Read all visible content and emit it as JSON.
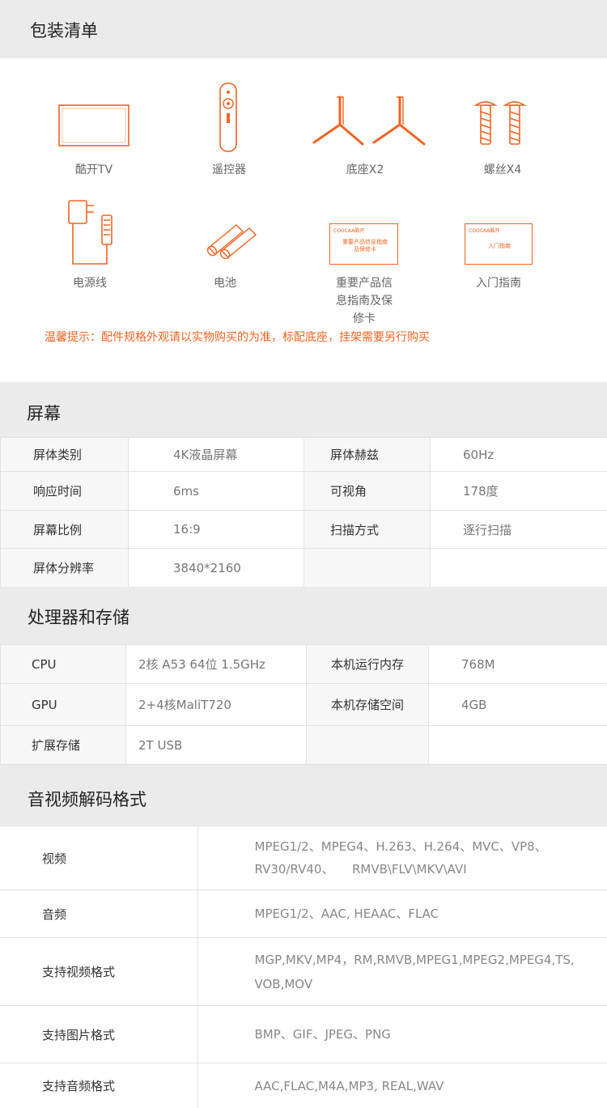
{
  "package": {
    "title": "包装清单",
    "items": [
      {
        "label": "酷开TV"
      },
      {
        "label": "遥控器"
      },
      {
        "label": "底座X2"
      },
      {
        "label": "螺丝X4"
      },
      {
        "label": "电源线"
      },
      {
        "label": "电池"
      },
      {
        "label": "重要产品信息指南及保修卡",
        "card_text": "重要产品信息指南及保修卡",
        "card_brand": "COOCAA酷开"
      },
      {
        "label": "入门指南",
        "card_text": "入门指南",
        "card_brand": "COOCAA酷开"
      }
    ],
    "tip": "温馨提示：配件规格外观请以实物购买的为准，标配底座，挂架需要另行购买"
  },
  "screen": {
    "title": "屏幕",
    "rows": [
      [
        "屏体类别",
        "4K液晶屏幕",
        "屏体赫兹",
        "60Hz"
      ],
      [
        "响应时间",
        "6ms",
        "可视角",
        "178度"
      ],
      [
        "屏幕比例",
        "16:9",
        "扫描方式",
        "逐行扫描"
      ],
      [
        "屏体分辨率",
        "3840*2160",
        "",
        ""
      ]
    ]
  },
  "processor": {
    "title": "处理器和存储",
    "rows": [
      [
        "CPU",
        "2核 A53 64位 1.5GHz",
        "本机运行内存",
        "768M"
      ],
      [
        "GPU",
        "2+4核MaliT720",
        "本机存储空间",
        "4GB"
      ],
      [
        "扩展存储",
        "2T USB",
        "",
        ""
      ]
    ]
  },
  "av": {
    "title": "音视频解码格式",
    "rows": [
      {
        "key": "视频",
        "value_line1": "MPEG1/2、MPEG4、H.263、H.264、MVC、VP8、",
        "value_line2": "RV30/RV40、　　RMVB\\FLV\\MKV\\AVI"
      },
      {
        "key": "音频",
        "value_line1": "MPEG1/2、AAC, HEAAC、FLAC",
        "value_line2": ""
      },
      {
        "key": "支持视频格式",
        "value_line1": "MGP,MKV,MP4，RM,RMVB,MPEG1,MPEG2,MPEG4,TS,",
        "value_line2": "VOB,MOV"
      },
      {
        "key": "支持图片格式",
        "value_line1": "BMP、GIF、JPEG、PNG",
        "value_line2": ""
      },
      {
        "key": "支持音频格式",
        "value_line1": "AAC,FLAC,M4A,MP3, REAL,WAV",
        "value_line2": ""
      }
    ]
  },
  "colors": {
    "accent": "#f26422",
    "section_bg": "#ebebeb",
    "border": "#e3e3e3"
  }
}
